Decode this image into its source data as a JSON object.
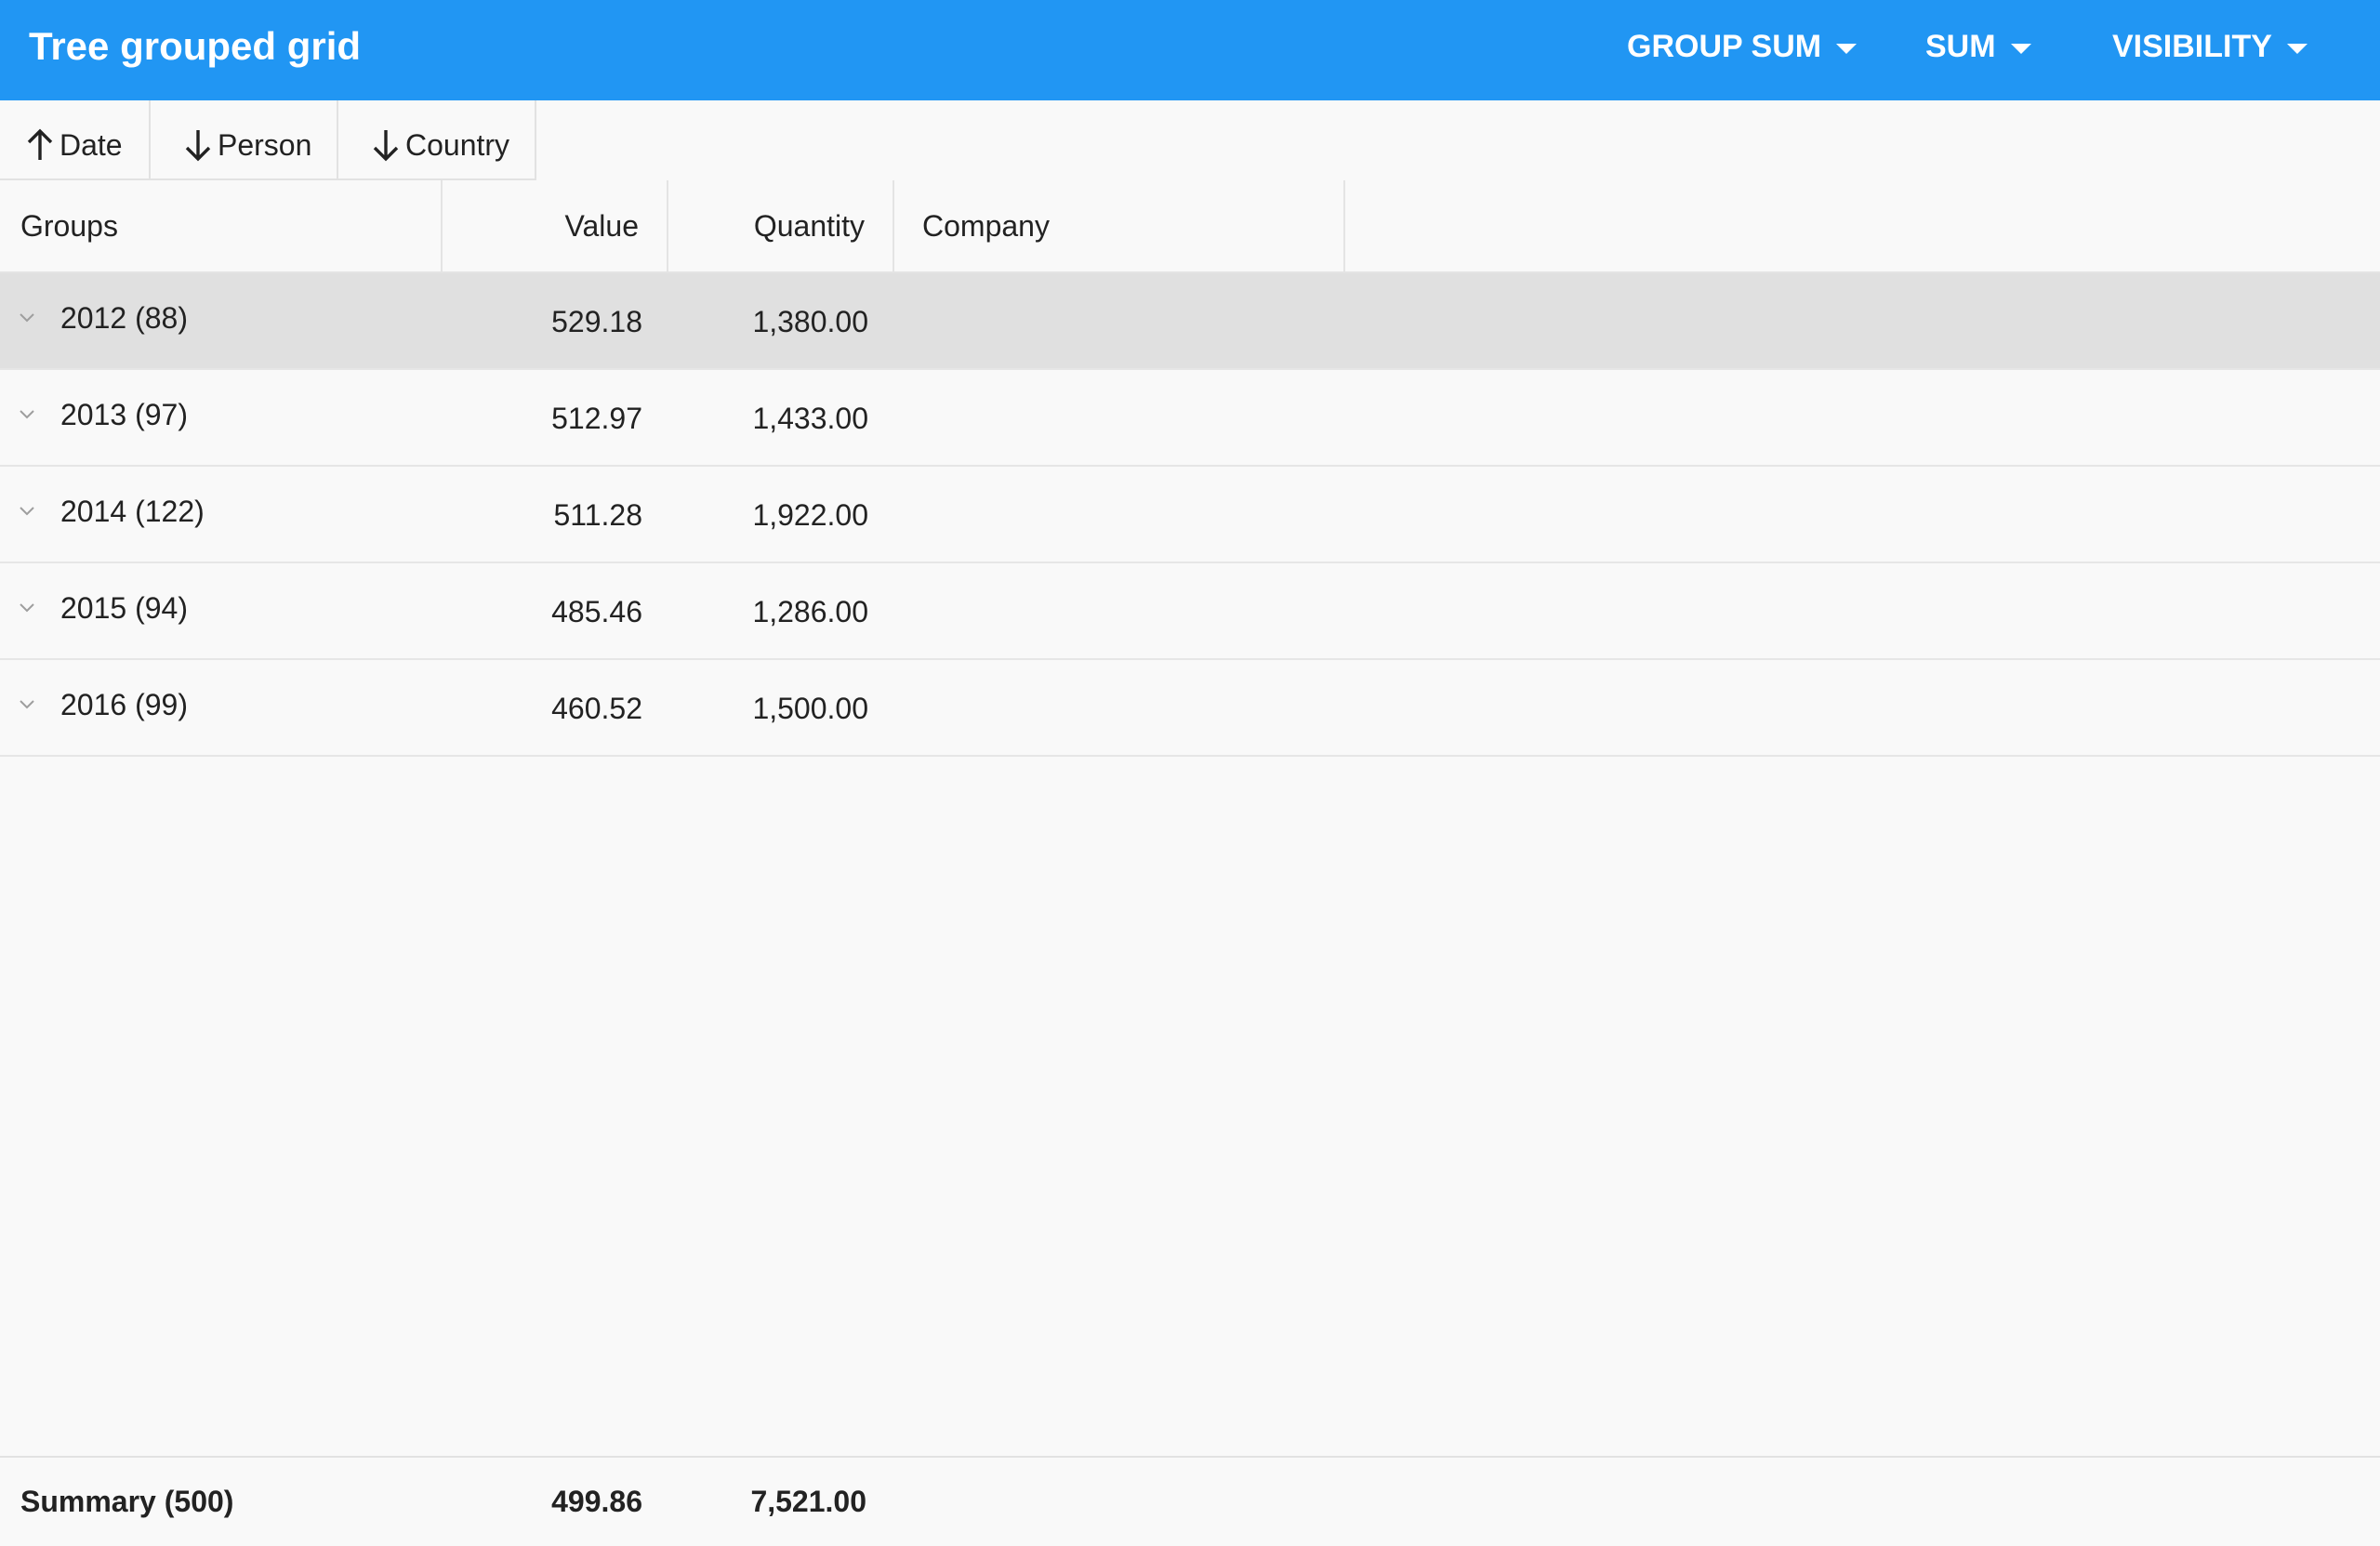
{
  "app": {
    "title": "Tree grouped grid",
    "accent_color": "#2196f3"
  },
  "toolbar": {
    "menus": [
      {
        "label": "GROUP SUM",
        "icon": "caret-down-icon"
      },
      {
        "label": "SUM",
        "icon": "caret-down-icon"
      },
      {
        "label": "VISIBILITY",
        "icon": "caret-down-icon"
      }
    ]
  },
  "grouping": {
    "chips": [
      {
        "label": "Date",
        "direction": "ascending",
        "icon": "arrow-up-icon"
      },
      {
        "label": "Person",
        "direction": "descending",
        "icon": "arrow-down-icon"
      },
      {
        "label": "Country",
        "direction": "descending",
        "icon": "arrow-down-icon"
      }
    ]
  },
  "grid": {
    "columns": [
      "Groups",
      "Value",
      "Quantity",
      "Company"
    ],
    "rows": [
      {
        "group": "2012 (88)",
        "value": "529.18",
        "quantity": "1,380.00",
        "selected": true
      },
      {
        "group": "2013 (97)",
        "value": "512.97",
        "quantity": "1,433.00",
        "selected": false
      },
      {
        "group": "2014 (122)",
        "value": "511.28",
        "quantity": "1,922.00",
        "selected": false
      },
      {
        "group": "2015 (94)",
        "value": "485.46",
        "quantity": "1,286.00",
        "selected": false
      },
      {
        "group": "2016 (99)",
        "value": "460.52",
        "quantity": "1,500.00",
        "selected": false
      }
    ],
    "summary": {
      "label": "Summary (500)",
      "value": "499.86",
      "quantity": "7,521.00"
    }
  }
}
